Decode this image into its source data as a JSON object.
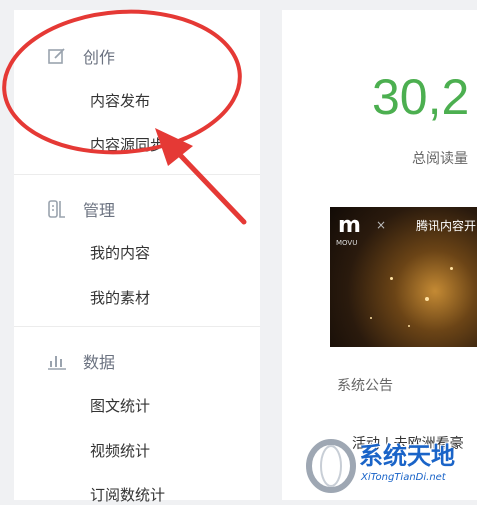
{
  "sidebar": {
    "sections": [
      {
        "label": "创作",
        "icon": "edit-icon",
        "items": [
          "内容发布",
          "内容源同步"
        ]
      },
      {
        "label": "管理",
        "icon": "manage-icon",
        "items": [
          "我的内容",
          "我的素材"
        ]
      },
      {
        "label": "数据",
        "icon": "bar-chart-icon",
        "items": [
          "图文统计",
          "视频统计",
          "订阅数统计"
        ]
      }
    ]
  },
  "main": {
    "total_reads_value": "30,2",
    "total_reads_label": "总阅读量",
    "banner": {
      "brand": "MOVU",
      "logo_mark": "m",
      "separator": "×",
      "partner": "腾讯内容开"
    },
    "notice_title": "系统公告",
    "notice_item": "活动 | 去欧洲看豪"
  },
  "watermark": {
    "name": "系统天地",
    "url": "XiTongTianDi.net"
  },
  "annotation": {
    "color": "#e53935"
  },
  "colors": {
    "accent_green": "#4caf50",
    "watermark_blue": "#1a64c8"
  }
}
